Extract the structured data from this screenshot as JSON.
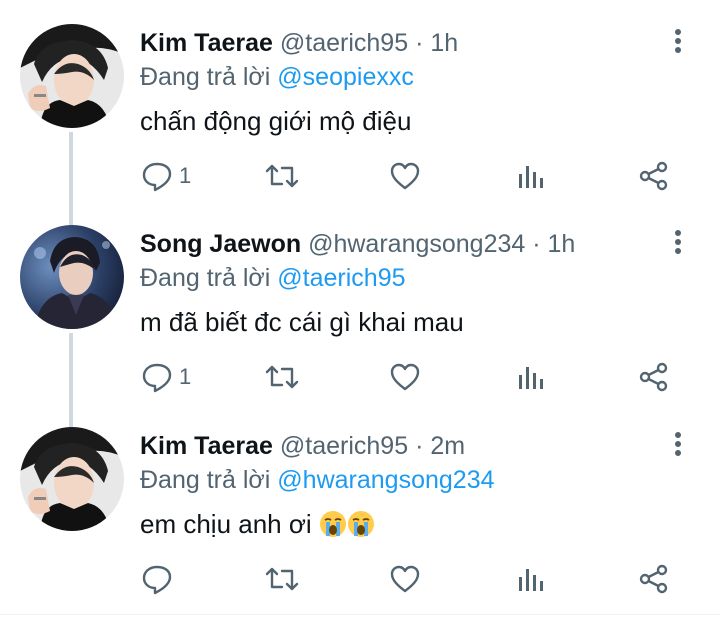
{
  "replying_prefix": "Đang trả lời",
  "tweets": [
    {
      "display_name": "Kim Taerae",
      "handle": "@taerich95",
      "separator": "·",
      "time": "1h",
      "reply_to": "@seopiexxc",
      "text": "chấn động giới mộ điệu",
      "emojis": [],
      "reply_count": "1",
      "avatar_icon": "avatar-photo-kim-taerae"
    },
    {
      "display_name": "Song Jaewon",
      "handle": "@hwarangsong234",
      "separator": "·",
      "time": "1h",
      "reply_to": "@taerich95",
      "text": "m đã biết đc cái gì khai mau",
      "emojis": [],
      "reply_count": "1",
      "avatar_icon": "avatar-photo-song-jaewon"
    },
    {
      "display_name": "Kim Taerae",
      "handle": "@taerich95",
      "separator": "·",
      "time": "2m",
      "reply_to": "@hwarangsong234",
      "text": "em chịu anh ơi ",
      "emojis": [
        "loudly-crying-face",
        "loudly-crying-face"
      ],
      "reply_count": "",
      "avatar_icon": "avatar-photo-kim-taerae"
    }
  ],
  "colors": {
    "text": "#0f1419",
    "secondary": "#536471",
    "accent": "#1d9bf0",
    "thread_line": "#cfd9de"
  },
  "icons": {
    "more": "more-vertical-icon",
    "reply": "reply-icon",
    "retweet": "retweet-icon",
    "like": "like-icon",
    "analytics": "analytics-icon",
    "share": "share-icon"
  }
}
